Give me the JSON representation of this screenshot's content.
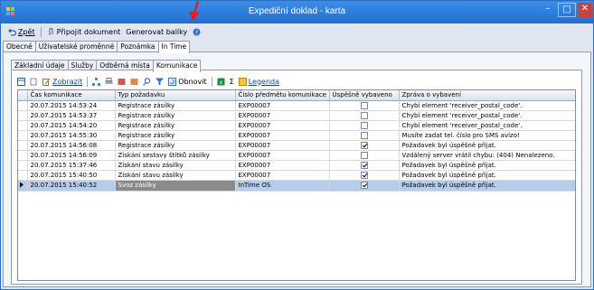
{
  "window": {
    "title": "Expediční doklad - karta",
    "minimize": "–",
    "maximize": "□",
    "close": "✕"
  },
  "toolbar": {
    "back_label": "Zpět",
    "attach_label": "Připojit dokument",
    "generate_label": "Generovat balíky"
  },
  "tabs_main": [
    {
      "label": "Obecné"
    },
    {
      "label": "Uživatelské proměnné"
    },
    {
      "label": "Poznámka"
    },
    {
      "label": "In Time"
    }
  ],
  "tabs_sub": [
    {
      "label": "Základní údaje"
    },
    {
      "label": "Služby"
    },
    {
      "label": "Odběrná místa"
    },
    {
      "label": "Komunikace"
    }
  ],
  "grid_toolbar": {
    "view_label": "Zobrazit",
    "refresh_label": "Obnovit",
    "legend_label": "Legenda",
    "sigma": "Σ"
  },
  "table": {
    "columns": [
      "Čas komunikace",
      "Typ požadavku",
      "Číslo předmětu komunikace",
      "Úspěšně vybaveno",
      "Zpráva o vybavení"
    ],
    "rows": [
      {
        "time": "20.07.2015 14:53:24",
        "type": "Registrace zásilky",
        "number": "EXP00007",
        "ok": false,
        "msg": "Chybí element 'receiver_postal_code'."
      },
      {
        "time": "20.07.2015 14:53:37",
        "type": "Registrace zásilky",
        "number": "EXP00007",
        "ok": false,
        "msg": "Chybí element 'receiver_postal_code'."
      },
      {
        "time": "20.07.2015 14:54:20",
        "type": "Registrace zásilky",
        "number": "EXP00007",
        "ok": false,
        "msg": "Chybí element 'receiver_postal_code'."
      },
      {
        "time": "20.07.2015 14:55:30",
        "type": "Registrace zásilky",
        "number": "EXP00007",
        "ok": false,
        "msg": "Musíte zadat tel. číslo pro SMS avízo!"
      },
      {
        "time": "20.07.2015 14:56:08",
        "type": "Registrace zásilky",
        "number": "EXP00007",
        "ok": true,
        "msg": "Požadavek byl úspěšně přijat."
      },
      {
        "time": "20.07.2015 14:56:09",
        "type": "Získání sestavy štítků zásilky",
        "number": "EXP00007",
        "ok": false,
        "msg": "Vzdálený server vrátil chybu: (404) Nenalezeno."
      },
      {
        "time": "20.07.2015 15:37:46",
        "type": "Získání stavu zásilky",
        "number": "EXP00007",
        "ok": true,
        "msg": "Požadavek byl úspěšně přijat."
      },
      {
        "time": "20.07.2015 15:40:50",
        "type": "Získání stavu zásilky",
        "number": "EXP00007",
        "ok": true,
        "msg": "Požadavek byl úspěšně přijat."
      },
      {
        "time": "20.07.2015 15:40:52",
        "type": "Svoz zásilky",
        "number": "InTime OS",
        "ok": true,
        "msg": "Požadavek byl úspěšně přijat.",
        "selected": true
      }
    ]
  },
  "colors": {
    "titlebar": "#2b7fe0",
    "selection": "#b6cdea",
    "annotation_arrow": "#e02020"
  }
}
